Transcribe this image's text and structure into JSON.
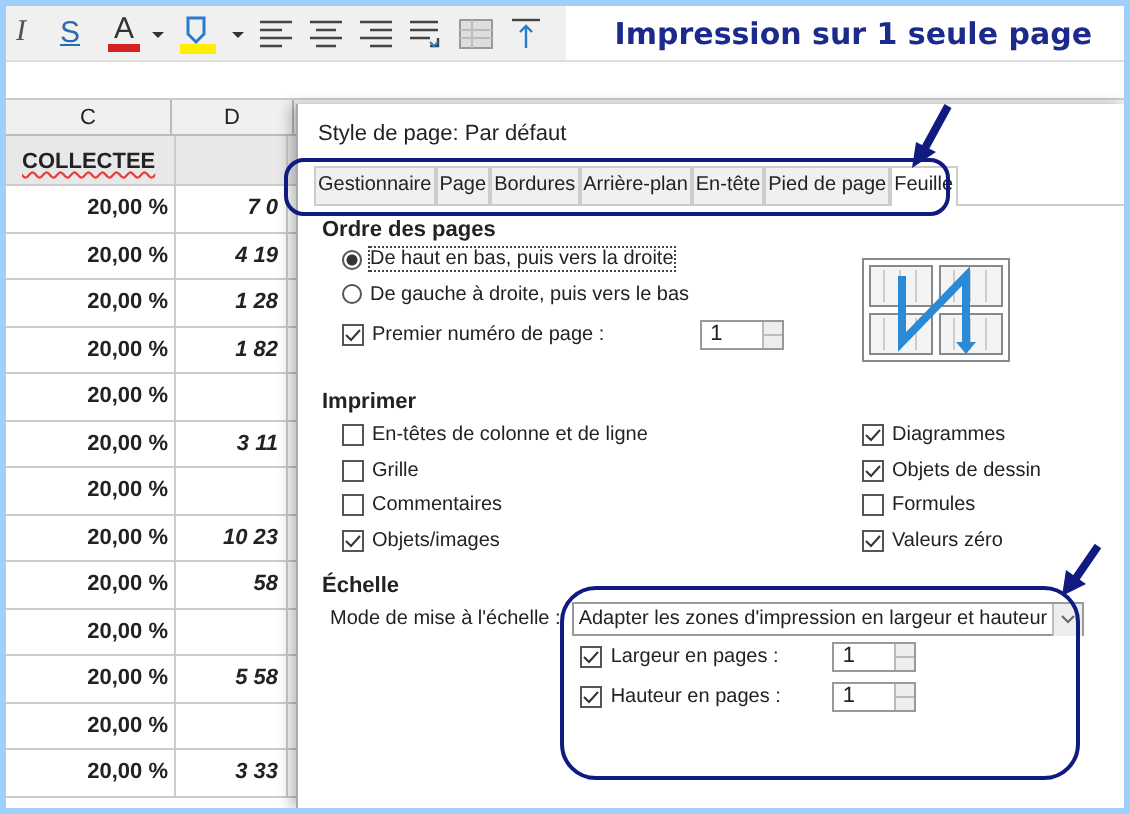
{
  "toolbar": {
    "italic": "I",
    "strike": "S",
    "font_color": "A"
  },
  "banner": "Impression sur 1 seule page",
  "sheet": {
    "columns": [
      "C",
      "D"
    ],
    "heading_cell": "COLLECTEE",
    "rows": [
      {
        "c": "20,00 %",
        "d": "7 0"
      },
      {
        "c": "20,00 %",
        "d": "4 19"
      },
      {
        "c": "20,00 %",
        "d": "1 28"
      },
      {
        "c": "20,00 %",
        "d": "1 82"
      },
      {
        "c": "20,00 %"
      },
      {
        "c": "20,00 %",
        "d": "3 11"
      },
      {
        "c": "20,00 %"
      },
      {
        "c": "20,00 %",
        "d": "10 23"
      },
      {
        "c": "20,00 %",
        "d": "58"
      },
      {
        "c": "20,00 %"
      },
      {
        "c": "20,00 %",
        "d": "5 58"
      },
      {
        "c": "20,00 %"
      },
      {
        "c": "20,00 %",
        "d": "3 33"
      }
    ]
  },
  "dialog": {
    "title": "Style de page: Par défaut",
    "tabs": [
      {
        "label": "Gestionnaire",
        "selected": false
      },
      {
        "label": "Page",
        "selected": false
      },
      {
        "label": "Bordures",
        "selected": false
      },
      {
        "label": "Arrière-plan",
        "selected": false
      },
      {
        "label": "En-tête",
        "selected": false
      },
      {
        "label": "Pied de page",
        "selected": false
      },
      {
        "label": "Feuille",
        "selected": true
      }
    ],
    "page_order": {
      "heading": "Ordre des pages",
      "options": [
        {
          "label": "De haut en bas, puis vers la droite",
          "selected": true
        },
        {
          "label": "De gauche à droite, puis vers le bas",
          "selected": false
        }
      ],
      "first_page_number": {
        "label": "Premier numéro de page :",
        "checked": true,
        "value": "1"
      }
    },
    "print": {
      "heading": "Imprimer",
      "options": [
        {
          "label": "En-têtes de colonne et de ligne",
          "checked": false
        },
        {
          "label": "Grille",
          "checked": false
        },
        {
          "label": "Commentaires",
          "checked": false
        },
        {
          "label": "Objets/images",
          "checked": true
        },
        {
          "label": "Diagrammes",
          "checked": true
        },
        {
          "label": "Objets de dessin",
          "checked": true
        },
        {
          "label": "Formules",
          "checked": false
        },
        {
          "label": "Valeurs zéro",
          "checked": true
        }
      ]
    },
    "scale": {
      "heading": "Échelle",
      "mode_label": "Mode de mise à l'échelle :",
      "mode_value": "Adapter les zones d'impression en largeur et hauteur",
      "fields": [
        {
          "label": "Largeur en pages :",
          "checked": true,
          "value": "1"
        },
        {
          "label": "Hauteur en pages :",
          "checked": true,
          "value": "1"
        }
      ]
    }
  }
}
